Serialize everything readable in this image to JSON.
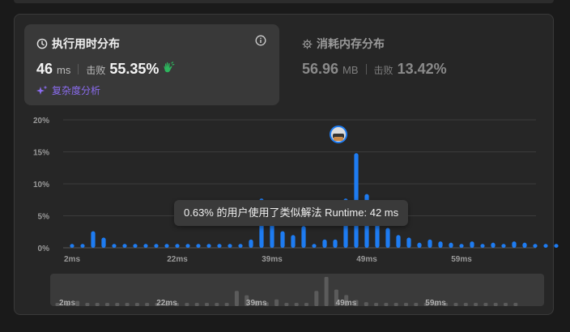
{
  "runtime": {
    "title": "执行用时分布",
    "value": "46",
    "unit": "ms",
    "beats_label": "击败",
    "beats_value": "55.35%",
    "complexity_link": "复杂度分析"
  },
  "memory": {
    "title": "消耗内存分布",
    "value": "56.96",
    "unit": "MB",
    "beats_label": "击败",
    "beats_value": "13.42%"
  },
  "tooltip": {
    "text": "0.63% 的用户使用了类似解法 Runtime: 42 ms"
  },
  "colors": {
    "bar": "#1e7cf2",
    "mini_bar": "#5b5b5b",
    "accent": "#8b6cf0",
    "clap": "#2db55d"
  },
  "chart_data": {
    "type": "bar",
    "x_tick_labels": [
      "2ms",
      "22ms",
      "39ms",
      "49ms",
      "59ms"
    ],
    "y_tick_labels": [
      "20%",
      "15%",
      "10%",
      "5%",
      "0%"
    ],
    "ylim": [
      0,
      20
    ],
    "grid": true,
    "values": [
      0.6,
      0.6,
      2.6,
      1.6,
      0.6,
      0.6,
      0.6,
      0.6,
      0.6,
      0.6,
      0.6,
      0.6,
      0.6,
      0.6,
      0.6,
      0.6,
      0.6,
      1.3,
      7.7,
      5.5,
      2.6,
      2.0,
      3.4,
      0.6,
      1.3,
      1.3,
      7.7,
      14.8,
      8.4,
      5.6,
      3.1,
      2.0,
      1.6,
      0.8,
      1.3,
      1.0,
      0.8,
      0.6,
      1.0,
      0.6,
      0.8,
      0.6,
      1.0,
      0.8,
      0.6,
      0.6,
      0.6
    ],
    "highlight_index": 27
  }
}
